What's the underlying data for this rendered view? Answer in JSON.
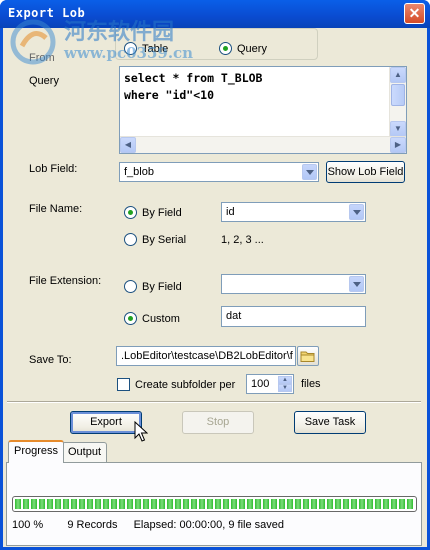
{
  "window": {
    "title": "Export Lob",
    "close_glyph": "✕"
  },
  "watermark": {
    "text_cn": "河东软件园",
    "url": "www.pc0359.cn"
  },
  "from": {
    "label": "From",
    "options": [
      {
        "label": "Table",
        "selected": false
      },
      {
        "label": "Query",
        "selected": true
      }
    ]
  },
  "query": {
    "label": "Query",
    "line1": "select * from T_BLOB",
    "line2": "where \"id\"<10"
  },
  "lob_field": {
    "label": "Lob Field:",
    "value": "f_blob",
    "show_button": "Show Lob Field"
  },
  "file_name": {
    "label": "File Name:",
    "by_field": {
      "label": "By Field",
      "selected": true,
      "value": "id"
    },
    "by_serial": {
      "label": "By Serial",
      "selected": false,
      "value": "1, 2, 3 ..."
    }
  },
  "file_extension": {
    "label": "File Extension:",
    "by_field": {
      "label": "By Field",
      "selected": false,
      "value": ""
    },
    "custom": {
      "label": "Custom",
      "selected": true,
      "value": "dat"
    }
  },
  "save_to": {
    "label": "Save To:",
    "path": ".LobEditor\\testcase\\DB2LobEditor\\f",
    "create_subfolder_label": "Create subfolder per",
    "create_subfolder_checked": false,
    "files_per_folder": "100",
    "files_label": "files"
  },
  "buttons": {
    "export": "Export",
    "stop": "Stop",
    "save_task": "Save Task"
  },
  "tabs": [
    {
      "label": "Progress",
      "active": true
    },
    {
      "label": "Output",
      "active": false
    }
  ],
  "progress": {
    "fraction": 1.0,
    "percent_text": "100 %",
    "records_text": "9 Records",
    "elapsed_text": "Elapsed: 00:00:00, 9 file saved"
  },
  "colors": {
    "title_bar": "#0a52d8",
    "dialog_bg": "#ece9d8",
    "progress_green": "#2fbd2f",
    "radio_selected": "#21a121"
  }
}
